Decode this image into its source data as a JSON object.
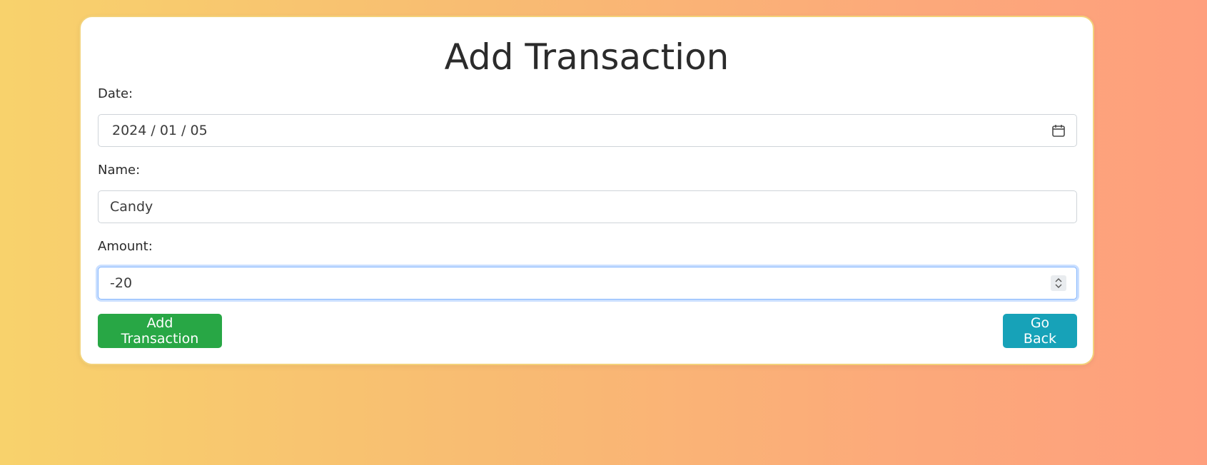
{
  "form": {
    "title": "Add Transaction",
    "date": {
      "label": "Date:",
      "value": "2024 / 01 / 05"
    },
    "name": {
      "label": "Name:",
      "value": "Candy"
    },
    "amount": {
      "label": "Amount:",
      "value": "-20"
    },
    "buttons": {
      "add_label": "Add Transaction",
      "back_label": "Go Back"
    }
  },
  "icons": {
    "date_picker": "calendar-icon",
    "amount_spinner": "spin-arrows-icon"
  },
  "colors": {
    "add_button": "#28a745",
    "back_button": "#17a2b8",
    "focus_ring": "#86b7fe"
  }
}
